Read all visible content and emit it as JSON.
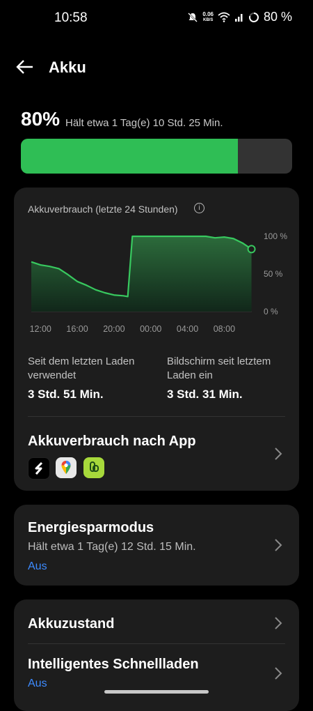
{
  "status": {
    "time": "10:58",
    "net_speed_value": "0.06",
    "net_speed_unit": "KB/S",
    "battery": "80 %"
  },
  "header": {
    "title": "Akku"
  },
  "battery": {
    "percent_label": "80%",
    "estimate": "Hält etwa 1 Tag(e) 10 Std. 25 Min.",
    "level_fraction": 0.8
  },
  "usage_card": {
    "title": "Akkuverbrauch (letzte 24 Stunden)",
    "stats": [
      {
        "label": "Seit dem letzten Laden verwendet",
        "value": "3 Std. 51 Min."
      },
      {
        "label": "Bildschirm seit letztem Laden ein",
        "value": "3 Std. 31 Min."
      }
    ],
    "by_app_title": "Akkuverbrauch nach App",
    "apps": [
      "speedify-icon",
      "google-maps-icon",
      "green-app-icon"
    ]
  },
  "chart_data": {
    "type": "area",
    "x_ticks": [
      "12:00",
      "16:00",
      "20:00",
      "00:00",
      "04:00",
      "08:00"
    ],
    "y_ticks": [
      "100 %",
      "50 %",
      "0 %"
    ],
    "ylim": [
      0,
      100
    ],
    "x": [
      "11:00",
      "12:00",
      "13:00",
      "14:00",
      "15:00",
      "16:00",
      "17:00",
      "18:00",
      "19:00",
      "20:00",
      "21:00",
      "21:30",
      "22:00",
      "23:00",
      "00:00",
      "01:00",
      "02:00",
      "03:00",
      "04:00",
      "05:00",
      "06:00",
      "07:00",
      "08:00",
      "09:00",
      "10:00",
      "10:58"
    ],
    "values": [
      66,
      62,
      60,
      57,
      49,
      40,
      35,
      29,
      25,
      22,
      21,
      20,
      100,
      100,
      100,
      100,
      100,
      100,
      100,
      100,
      100,
      98,
      99,
      97,
      91,
      83
    ],
    "color": "#38c95f"
  },
  "power_saving": {
    "title": "Energiesparmodus",
    "subtitle": "Hält etwa 1 Tag(e) 12 Std. 15 Min.",
    "state": "Aus"
  },
  "health": {
    "title": "Akkuzustand"
  },
  "smart_charge": {
    "title": "Intelligentes Schnellladen",
    "state": "Aus"
  }
}
